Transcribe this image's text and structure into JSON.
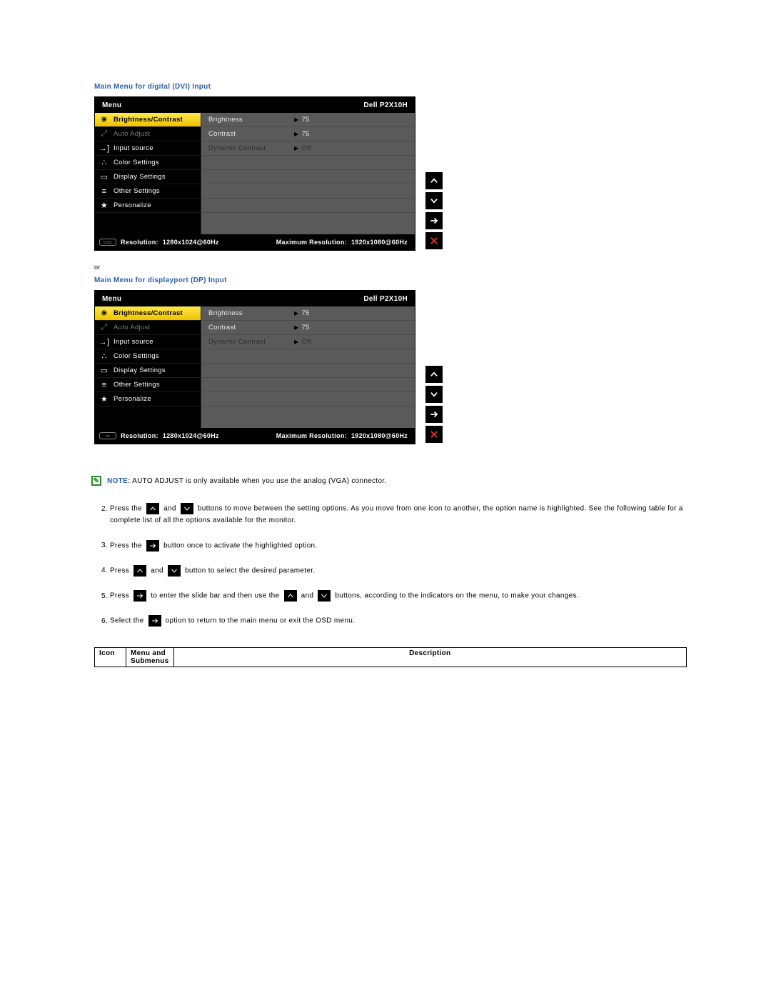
{
  "heading_dvi": "Main Menu for digital (DVI) Input",
  "or": "or",
  "heading_dp": "Main Menu for displayport (DP) Input",
  "osd": {
    "menu_label": "Menu",
    "model": "Dell P2X10H",
    "left_items": [
      {
        "icon": "brightness",
        "label": "Brightness/Contrast",
        "state": "sel"
      },
      {
        "icon": "auto",
        "label": "Auto Adjust",
        "state": "dim"
      },
      {
        "icon": "input",
        "label": "Input source",
        "state": ""
      },
      {
        "icon": "color",
        "label": "Color Settings",
        "state": ""
      },
      {
        "icon": "display",
        "label": "Display Settings",
        "state": ""
      },
      {
        "icon": "other",
        "label": "Other Settings",
        "state": ""
      },
      {
        "icon": "star",
        "label": "Personalize",
        "state": ""
      }
    ],
    "right_items": [
      {
        "label": "Brightness",
        "value": "75",
        "state": ""
      },
      {
        "label": "Contrast",
        "value": "75",
        "state": ""
      },
      {
        "label": "Dynamic Contrast",
        "value": "Off",
        "state": "dim"
      }
    ],
    "bottom": {
      "res_label": "Resolution:",
      "res_value": "1280x1024@60Hz",
      "max_label": "Maximum Resolution:",
      "max_value": "1920x1080@60Hz"
    }
  },
  "note": {
    "label": "NOTE:",
    "text": "AUTO ADJUST is only available when you use the analog (VGA) connector."
  },
  "steps": {
    "s2a": "Press the",
    "s2b": "and",
    "s2c": "buttons to move between the setting options. As you move from one icon to another, the option name is highlighted. See the following table for a complete list of all the options available for the monitor.",
    "s3a": "Press the",
    "s3b": "button once to activate the highlighted option.",
    "s4a": "Press",
    "s4b": "and",
    "s4c": "button to select the desired parameter.",
    "s5a": "Press",
    "s5b": "to enter the slide bar and then use the",
    "s5c": "and",
    "s5d": "buttons, according to the indicators on the menu, to make your changes.",
    "s6a": "Select the",
    "s6b": "option to return to the main menu or exit the OSD menu."
  },
  "table": {
    "h1": "Icon",
    "h2": "Menu and Submenus",
    "h3": "Description"
  }
}
